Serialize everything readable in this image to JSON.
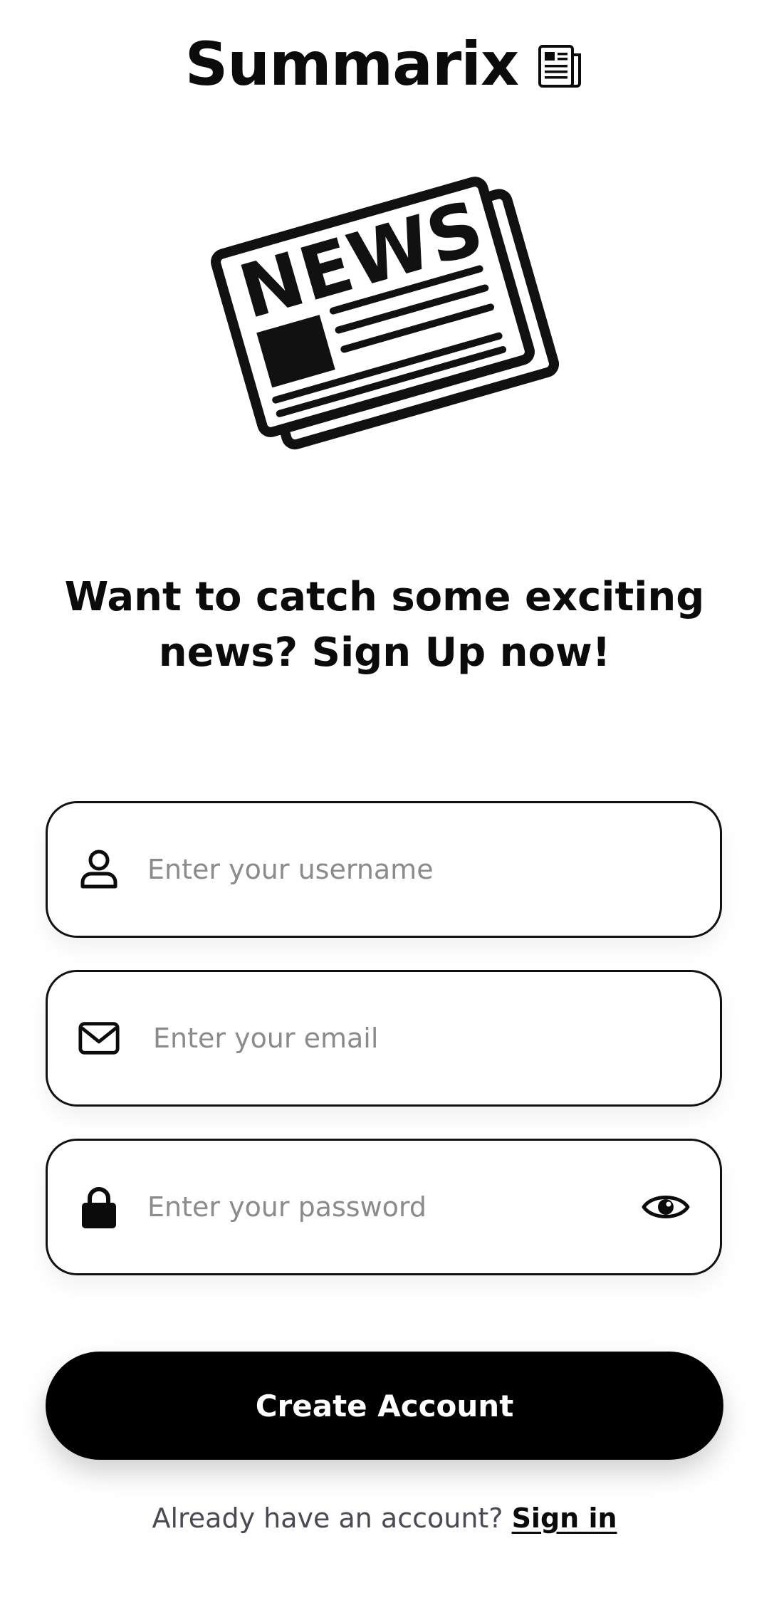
{
  "header": {
    "title": "Summarix",
    "title_icon": "newspaper-icon"
  },
  "hero": {
    "icon": "news-illustration-icon",
    "lettering": "NEWS"
  },
  "headline": {
    "line1": "Want to catch some exciting",
    "line2_prefix": "news? ",
    "line2_emphasis": "Sign Up",
    "line2_suffix": " now!"
  },
  "form": {
    "username": {
      "icon": "user-icon",
      "placeholder": "Enter your username",
      "value": ""
    },
    "email": {
      "icon": "envelope-icon",
      "placeholder": "Enter your email",
      "value": ""
    },
    "password": {
      "icon": "lock-icon",
      "placeholder": "Enter your password",
      "value": "",
      "toggle_icon": "eye-icon"
    }
  },
  "actions": {
    "create_account": "Create Account"
  },
  "footer": {
    "prompt": "Already have an account? ",
    "signin_link": "Sign in"
  },
  "colors": {
    "background": "#ffffff",
    "primary": "#000000",
    "text": "#0b0b0b",
    "placeholder": "#8b8b8b",
    "muted_text": "#4a4a55"
  }
}
